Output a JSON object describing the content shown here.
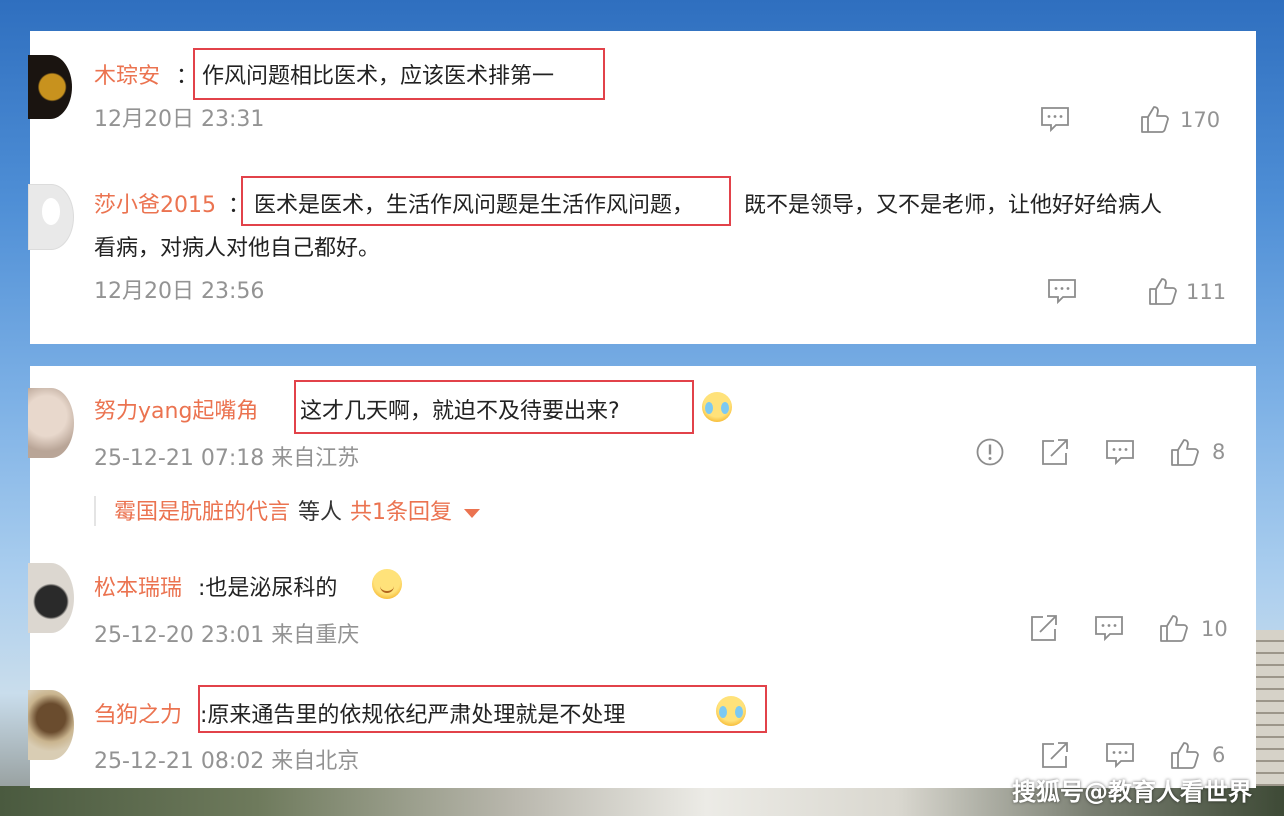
{
  "comments_top": [
    {
      "user": "木琮安",
      "separator": "：",
      "text": "作风问题相比医术，应该医术排第一",
      "time": "12月20日 23:31",
      "likes": "170"
    },
    {
      "user": "莎小爸2015",
      "separator": "：",
      "text_boxed": "医术是医术，生活作风问题是生活作风问题，",
      "text_rest": "既不是领导，又不是老师，让他好好给病人",
      "text_line2": "看病，对病人对他自己都好。",
      "time": "12月20日 23:56",
      "likes": "111"
    }
  ],
  "comments_bottom": [
    {
      "user": "努力yang起嘴角",
      "text": "这才几天啊，就迫不及待要出来?",
      "emoji": "crying-laughing-emoji",
      "time": "25-12-21 07:18 来自江苏",
      "likes": "8",
      "reply": {
        "user": "霉国是肮脏的代言",
        "middle": "等人",
        "count": "共1条回复"
      }
    },
    {
      "user": "松本瑞瑞",
      "text": ":也是泌尿科的",
      "emoji": "smile-emoji",
      "time": "25-12-20 23:01 来自重庆",
      "likes": "10"
    },
    {
      "user": "刍狗之力",
      "text": ":原来通告里的依规依纪严肃处理就是不处理",
      "emoji": "crying-laughing-emoji",
      "time": "25-12-21 08:02 来自北京",
      "likes": "6"
    }
  ],
  "watermark": "搜狐号@教育人看世界",
  "colors": {
    "username": "#eb7350",
    "highlight_box": "#e2424a",
    "meta": "#939393"
  },
  "icons": [
    "comment-icon",
    "like-icon",
    "report-icon",
    "share-icon"
  ]
}
